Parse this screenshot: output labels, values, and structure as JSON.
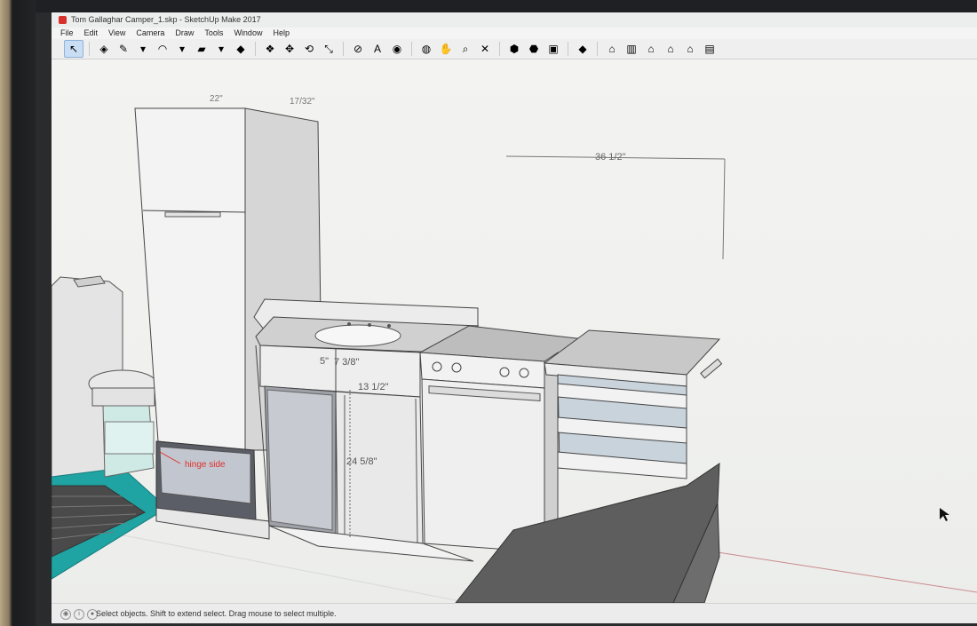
{
  "window": {
    "title": "Tom Gallaghar Camper_1.skp - SketchUp Make 2017"
  },
  "menu": [
    "File",
    "Edit",
    "View",
    "Camera",
    "Draw",
    "Tools",
    "Window",
    "Help"
  ],
  "toolbar": {
    "tools": [
      {
        "name": "select-tool",
        "glyph": "↖",
        "active": true
      },
      {
        "name": "eraser-tool",
        "glyph": "◈"
      },
      {
        "name": "line-tool",
        "glyph": "✎"
      },
      {
        "name": "line-dropdown",
        "glyph": "▾"
      },
      {
        "name": "arc-tool",
        "glyph": "◠"
      },
      {
        "name": "arc-dropdown",
        "glyph": "▾"
      },
      {
        "name": "shape-tool",
        "glyph": "▰"
      },
      {
        "name": "shape-dropdown",
        "glyph": "▾"
      },
      {
        "name": "pushpull-tool",
        "glyph": "◆"
      },
      {
        "name": "offset-tool",
        "glyph": "❖"
      },
      {
        "name": "move-tool",
        "glyph": "✥"
      },
      {
        "name": "rotate-tool",
        "glyph": "⟲"
      },
      {
        "name": "scale-tool",
        "glyph": "⤡"
      },
      {
        "name": "tape-measure-tool",
        "glyph": "⊘"
      },
      {
        "name": "text-tool",
        "glyph": "A"
      },
      {
        "name": "paint-bucket-tool",
        "glyph": "◉"
      },
      {
        "name": "orbit-tool",
        "glyph": "◍"
      },
      {
        "name": "pan-tool",
        "glyph": "✋"
      },
      {
        "name": "zoom-tool",
        "glyph": "⌕"
      },
      {
        "name": "zoom-extents-tool",
        "glyph": "✕"
      },
      {
        "name": "warehouse-tool",
        "glyph": "⬢"
      },
      {
        "name": "extension-tool",
        "glyph": "⬣"
      },
      {
        "name": "share-model-tool",
        "glyph": "▣"
      },
      {
        "name": "ruby-tool",
        "glyph": "◆"
      },
      {
        "name": "iso-view",
        "glyph": "⌂"
      },
      {
        "name": "top-view",
        "glyph": "▥"
      },
      {
        "name": "front-view",
        "glyph": "⌂"
      },
      {
        "name": "right-view",
        "glyph": "⌂"
      },
      {
        "name": "back-view",
        "glyph": "⌂"
      },
      {
        "name": "left-view",
        "glyph": "▤"
      }
    ]
  },
  "dimensions": {
    "top_22": "22\"",
    "top_17": "17/32\"",
    "width_36": "36 1/2\"",
    "d_5": "5\"",
    "d_7": "7 3/8\"",
    "d_13": "13 1/2\"",
    "d_24": "24 5/8\""
  },
  "annotations": {
    "hinge": "hinge side"
  },
  "colors": {
    "accent_teal": "#1fa3a3",
    "annotation_red": "#e0302a",
    "toolbar_active": "#c9ddf3"
  },
  "status": {
    "message": "Select objects. Shift to extend select. Drag mouse to select multiple."
  }
}
